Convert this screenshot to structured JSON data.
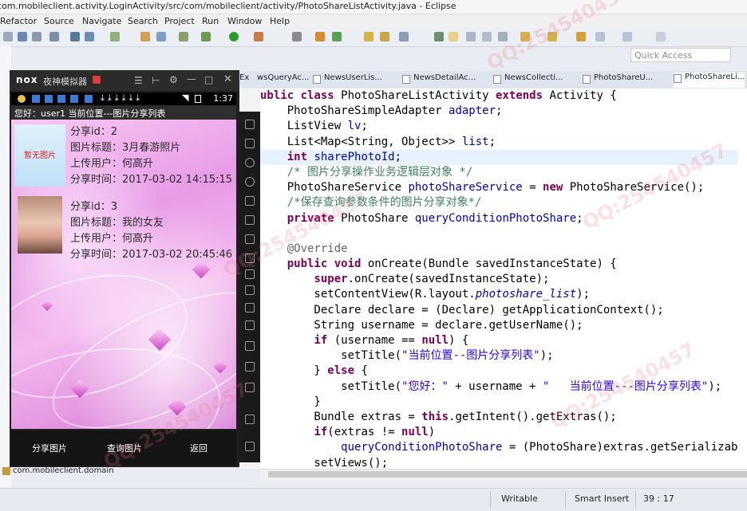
{
  "window": {
    "title": "com.mobileclient.activity.LoginActivity/src/com/mobileclient/activity/PhotoShareListActivity.java - Eclipse"
  },
  "menu": [
    "Refactor",
    "Source",
    "Navigate",
    "Search",
    "Project",
    "Run",
    "Window",
    "Help"
  ],
  "quick_access": {
    "placeholder": "Quick Access"
  },
  "editor_tabs": [
    "Ex",
    "wsQueryAc...",
    "NewsUserLis...",
    "NewsDetailAc...",
    "NewsCollecti...",
    "PhotoShareU...",
    "PhotoShareLi..."
  ],
  "code_lines": [
    [
      {
        "t": "ublic class ",
        "c": "kw"
      },
      {
        "t": "PhotoShareListActivity ",
        "c": ""
      },
      {
        "t": "extends ",
        "c": "kw"
      },
      {
        "t": "Activity {",
        "c": ""
      }
    ],
    [
      {
        "t": "    PhotoShareSimpleAdapter ",
        "c": ""
      },
      {
        "t": "adapter",
        "c": "fld"
      },
      {
        "t": ";",
        "c": ""
      }
    ],
    [
      {
        "t": "    ListView ",
        "c": ""
      },
      {
        "t": "lv",
        "c": "fld"
      },
      {
        "t": ";",
        "c": ""
      }
    ],
    [
      {
        "t": "    List<Map<String, Object>> ",
        "c": ""
      },
      {
        "t": "list",
        "c": "fld"
      },
      {
        "t": ";",
        "c": ""
      }
    ],
    [
      {
        "t": "    ",
        "c": ""
      },
      {
        "t": "int ",
        "c": "kw"
      },
      {
        "t": "sharePhotoId",
        "c": "fld"
      },
      {
        "t": ";",
        "c": ""
      }
    ],
    [
      {
        "t": "    /* 图片分享操作业务逻辑层对象 */",
        "c": "cm"
      }
    ],
    [
      {
        "t": "    PhotoShareService ",
        "c": ""
      },
      {
        "t": "photoShareService",
        "c": "fld"
      },
      {
        "t": " = ",
        "c": ""
      },
      {
        "t": "new ",
        "c": "kw"
      },
      {
        "t": "PhotoShareService();",
        "c": ""
      }
    ],
    [
      {
        "t": "    /*保存查询参数条件的图片分享对象*/",
        "c": "cm"
      }
    ],
    [
      {
        "t": "    ",
        "c": ""
      },
      {
        "t": "private ",
        "c": "kw"
      },
      {
        "t": "PhotoShare ",
        "c": ""
      },
      {
        "t": "queryConditionPhotoShare",
        "c": "fld"
      },
      {
        "t": ";",
        "c": ""
      }
    ],
    [
      {
        "t": "",
        "c": ""
      }
    ],
    [
      {
        "t": "    @Override",
        "c": "an"
      }
    ],
    [
      {
        "t": "    ",
        "c": ""
      },
      {
        "t": "public void ",
        "c": "kw"
      },
      {
        "t": "onCreate(Bundle savedInstanceState) {",
        "c": ""
      }
    ],
    [
      {
        "t": "        ",
        "c": ""
      },
      {
        "t": "super",
        "c": "kw"
      },
      {
        "t": ".onCreate(savedInstanceState);",
        "c": ""
      }
    ],
    [
      {
        "t": "        setContentView(R.layout.",
        "c": ""
      },
      {
        "t": "photoshare_list",
        "c": "fld it"
      },
      {
        "t": ");",
        "c": ""
      }
    ],
    [
      {
        "t": "        Declare declare = (Declare) getApplicationContext();",
        "c": ""
      }
    ],
    [
      {
        "t": "        String username = declare.getUserName();",
        "c": ""
      }
    ],
    [
      {
        "t": "        ",
        "c": ""
      },
      {
        "t": "if ",
        "c": "kw"
      },
      {
        "t": "(username == ",
        "c": ""
      },
      {
        "t": "null",
        "c": "kw"
      },
      {
        "t": ") {",
        "c": ""
      }
    ],
    [
      {
        "t": "            setTitle(",
        "c": ""
      },
      {
        "t": "\"当前位置--图片分享列表\"",
        "c": "st"
      },
      {
        "t": ");",
        "c": ""
      }
    ],
    [
      {
        "t": "        } ",
        "c": ""
      },
      {
        "t": "else ",
        "c": "kw"
      },
      {
        "t": "{",
        "c": ""
      }
    ],
    [
      {
        "t": "            setTitle(",
        "c": ""
      },
      {
        "t": "\"您好：\"",
        "c": "st"
      },
      {
        "t": " + username + ",
        "c": ""
      },
      {
        "t": "\"   当前位置---图片分享列表\"",
        "c": "st"
      },
      {
        "t": ");",
        "c": ""
      }
    ],
    [
      {
        "t": "        }",
        "c": ""
      }
    ],
    [
      {
        "t": "        Bundle extras = ",
        "c": ""
      },
      {
        "t": "this",
        "c": "kw"
      },
      {
        "t": ".getIntent().getExtras();",
        "c": ""
      }
    ],
    [
      {
        "t": "        ",
        "c": ""
      },
      {
        "t": "if",
        "c": "kw"
      },
      {
        "t": "(extras != ",
        "c": ""
      },
      {
        "t": "null",
        "c": "kw"
      },
      {
        "t": ")",
        "c": ""
      }
    ],
    [
      {
        "t": "            ",
        "c": ""
      },
      {
        "t": "queryConditionPhotoShare",
        "c": "fld"
      },
      {
        "t": " = (PhotoShare)extras.getSerializab",
        "c": ""
      }
    ],
    [
      {
        "t": "        setViews();",
        "c": ""
      }
    ]
  ],
  "status": {
    "mode": "Writable",
    "insert": "Smart Insert",
    "position": "39 : 17"
  },
  "package_row": "com.mobileclient.domain",
  "emulator": {
    "brand": "nox",
    "name": "夜神模拟器",
    "clock": "1:37",
    "app_title": "您好：user1  当前位置---图片分享列表",
    "items": [
      {
        "id": "分享id：2",
        "title": "图片标题：3月春游照片",
        "user": "上传用户：何高升",
        "time": "分享时间：2017-03-02 14:15:15",
        "thumb_text": "暂无图片"
      },
      {
        "id": "分享id：3",
        "title": "图片标题：我的女友",
        "user": "上传用户：何高升",
        "time": "分享时间：2017-03-02 20:45:46",
        "thumb_text": ""
      }
    ],
    "nav": [
      "分享图片",
      "查询图片",
      "返回"
    ]
  },
  "watermark": "QQ:254540457"
}
